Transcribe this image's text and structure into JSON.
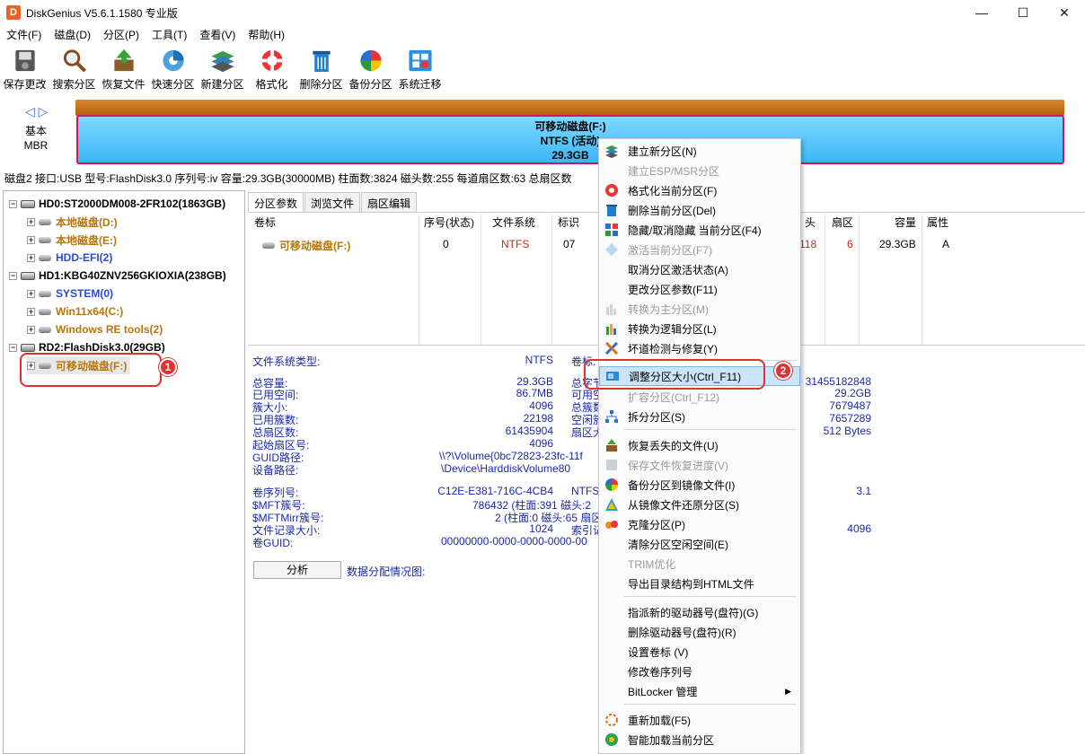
{
  "window": {
    "title": "DiskGenius V5.6.1.1580 专业版",
    "app_icon_letter": "D",
    "minimize": "—",
    "maximize": "☐",
    "close": "✕"
  },
  "menu": [
    "文件(F)",
    "磁盘(D)",
    "分区(P)",
    "工具(T)",
    "查看(V)",
    "帮助(H)"
  ],
  "toolbar": [
    {
      "label": "保存更改",
      "icon": "save-disk-icon"
    },
    {
      "label": "搜索分区",
      "icon": "magnifier-icon"
    },
    {
      "label": "恢复文件",
      "icon": "recover-box-icon"
    },
    {
      "label": "快速分区",
      "icon": "quick-partition-icon"
    },
    {
      "label": "新建分区",
      "icon": "layers-icon"
    },
    {
      "label": "格式化",
      "icon": "lifebuoy-icon"
    },
    {
      "label": "删除分区",
      "icon": "trash-icon"
    },
    {
      "label": "备份分区",
      "icon": "pie-icon"
    },
    {
      "label": "系统迁移",
      "icon": "windows-migrate-icon"
    }
  ],
  "diskbar": {
    "nav": "◁ ▷",
    "kind_line1": "基本",
    "kind_line2": "MBR",
    "partition_name": "可移动磁盘(F:)",
    "partition_fs": "NTFS (活动)",
    "partition_size": "29.3GB"
  },
  "disk_info": "磁盘2 接口:USB  型号:FlashDisk3.0  序列号:iv  容量:29.3GB(30000MB)  柱面数:3824  磁头数:255  每道扇区数:63  总扇区数",
  "tree": [
    {
      "label": "HD0:ST2000DM008-2FR102(1863GB)",
      "level": 0,
      "color": "dark"
    },
    {
      "label": "本地磁盘(D:)",
      "level": 1,
      "color": "brown"
    },
    {
      "label": "本地磁盘(E:)",
      "level": 1,
      "color": "brown"
    },
    {
      "label": "HDD-EFI(2)",
      "level": 1,
      "color": "blue"
    },
    {
      "label": "HD1:KBG40ZNV256GKIOXIA(238GB)",
      "level": 0,
      "color": "dark"
    },
    {
      "label": "SYSTEM(0)",
      "level": 1,
      "color": "blue"
    },
    {
      "label": "Win11x64(C:)",
      "level": 1,
      "color": "brown"
    },
    {
      "label": "Windows RE tools(2)",
      "level": 1,
      "color": "brown"
    },
    {
      "label": "RD2:FlashDisk3.0(29GB)",
      "level": 0,
      "color": "dark"
    },
    {
      "label": "可移动磁盘(F:)",
      "level": 1,
      "color": "brown"
    }
  ],
  "tabs": [
    "分区参数",
    "浏览文件",
    "扇区编辑"
  ],
  "grid": {
    "headers": {
      "volume": "卷标",
      "index": "序号(状态)",
      "fs": "文件系统",
      "id": "标识",
      "head": "头",
      "sector": "扇区",
      "capacity": "容量",
      "attr": "属性"
    },
    "row": {
      "volume": "可移动磁盘(F:)",
      "index": "0",
      "fs": "NTFS",
      "id": "07",
      "head": "118",
      "sector": "6",
      "capacity": "29.3GB",
      "attr": "A"
    }
  },
  "details": {
    "fs_type_label": "文件系统类型:",
    "fs_type_value": "NTFS",
    "vol_label_label": "卷标:",
    "rows_left": [
      {
        "label": "总容量:",
        "value": "29.3GB"
      },
      {
        "label": "已用空间:",
        "value": "86.7MB"
      },
      {
        "label": "簇大小:",
        "value": "4096"
      },
      {
        "label": "已用簇数:",
        "value": "22198"
      },
      {
        "label": "总扇区数:",
        "value": "61435904"
      },
      {
        "label": "起始扇区号:",
        "value": "4096"
      },
      {
        "label": "GUID路径:",
        "value": "\\\\?\\Volume{0bc72823-23fc-11f"
      },
      {
        "label": "设备路径:",
        "value": "\\Device\\HarddiskVolume80"
      }
    ],
    "rows_mid": [
      "总字节",
      "可用空",
      "总簇数",
      "空闲簇",
      "扇区大",
      ""
    ],
    "rows_right": [
      "31455182848",
      "29.2GB",
      "7679487",
      "7657289",
      "512 Bytes"
    ],
    "rows2": [
      {
        "label": "卷序列号:",
        "value": "C12E-E381-716C-4CB4",
        "mid": "NTFS",
        "right": "3.1"
      },
      {
        "label": "$MFT簇号:",
        "value": "786432 (柱面:391 磁头:2",
        "mid": "",
        "right": ""
      },
      {
        "label": "$MFTMirr簇号:",
        "value": "2 (柱面:0 磁头:65 扇区",
        "mid": "",
        "right": ""
      },
      {
        "label": "文件记录大小:",
        "value": "1024",
        "mid": "索引记",
        "right": "4096"
      },
      {
        "label": "卷GUID:",
        "value": "00000000-0000-0000-0000-00",
        "mid": "",
        "right": ""
      }
    ],
    "analyze_button": "分析",
    "alloc_label": "数据分配情况图:"
  },
  "context_menu": [
    {
      "label": "建立新分区(N)",
      "disabled": false,
      "icon": "new-partition-icon"
    },
    {
      "label": "建立ESP/MSR分区",
      "disabled": true,
      "icon": ""
    },
    {
      "label": "格式化当前分区(F)",
      "disabled": false,
      "icon": "format-icon"
    },
    {
      "label": "删除当前分区(Del)",
      "disabled": false,
      "icon": "delete-icon"
    },
    {
      "label": "隐藏/取消隐藏 当前分区(F4)",
      "disabled": false,
      "icon": "hide-icon"
    },
    {
      "label": "激活当前分区(F7)",
      "disabled": true,
      "icon": "activate-icon"
    },
    {
      "label": "取消分区激活状态(A)",
      "disabled": false,
      "icon": ""
    },
    {
      "label": "更改分区参数(F11)",
      "disabled": false,
      "icon": ""
    },
    {
      "label": "转换为主分区(M)",
      "disabled": true,
      "icon": "convert-primary-icon"
    },
    {
      "label": "转换为逻辑分区(L)",
      "disabled": false,
      "icon": "convert-logical-icon"
    },
    {
      "label": "坏道检测与修复(Y)",
      "disabled": false,
      "icon": "tools-icon"
    },
    {
      "label": "调整分区大小(Ctrl_F11)",
      "disabled": false,
      "icon": "resize-icon"
    },
    {
      "label": "扩容分区(Ctrl_F12)",
      "disabled": true,
      "icon": ""
    },
    {
      "label": "拆分分区(S)",
      "disabled": false,
      "icon": "split-icon"
    },
    {
      "label": "恢复丢失的文件(U)",
      "disabled": false,
      "icon": "recover-icon"
    },
    {
      "label": "保存文件恢复进度(V)",
      "disabled": true,
      "icon": "save-progress-icon"
    },
    {
      "label": "备份分区到镜像文件(I)",
      "disabled": false,
      "icon": "backup-icon"
    },
    {
      "label": "从镜像文件还原分区(S)",
      "disabled": false,
      "icon": "restore-icon"
    },
    {
      "label": "克隆分区(P)",
      "disabled": false,
      "icon": "clone-icon"
    },
    {
      "label": "清除分区空闲空间(E)",
      "disabled": false,
      "icon": ""
    },
    {
      "label": "TRIM优化",
      "disabled": true,
      "icon": ""
    },
    {
      "label": "导出目录结构到HTML文件",
      "disabled": false,
      "icon": ""
    },
    {
      "label": "指派新的驱动器号(盘符)(G)",
      "disabled": false,
      "icon": ""
    },
    {
      "label": "删除驱动器号(盘符)(R)",
      "disabled": false,
      "icon": ""
    },
    {
      "label": "设置卷标 (V)",
      "disabled": false,
      "icon": ""
    },
    {
      "label": "修改卷序列号",
      "disabled": false,
      "icon": ""
    },
    {
      "label": "BitLocker 管理",
      "disabled": false,
      "icon": ""
    },
    {
      "label": "重新加载(F5)",
      "disabled": false,
      "icon": "reload-icon"
    },
    {
      "label": "智能加载当前分区",
      "disabled": false,
      "icon": "smart-load-icon"
    }
  ],
  "badges": {
    "one": "1",
    "two": "2"
  },
  "submenu_arrow": "▶",
  "colors": {
    "accent_red": "#e03030",
    "brown": "#b8760a",
    "blue_text": "#1a2aa8",
    "partition_blue": "#3bb6f5",
    "highlight": "#cce4f7"
  }
}
